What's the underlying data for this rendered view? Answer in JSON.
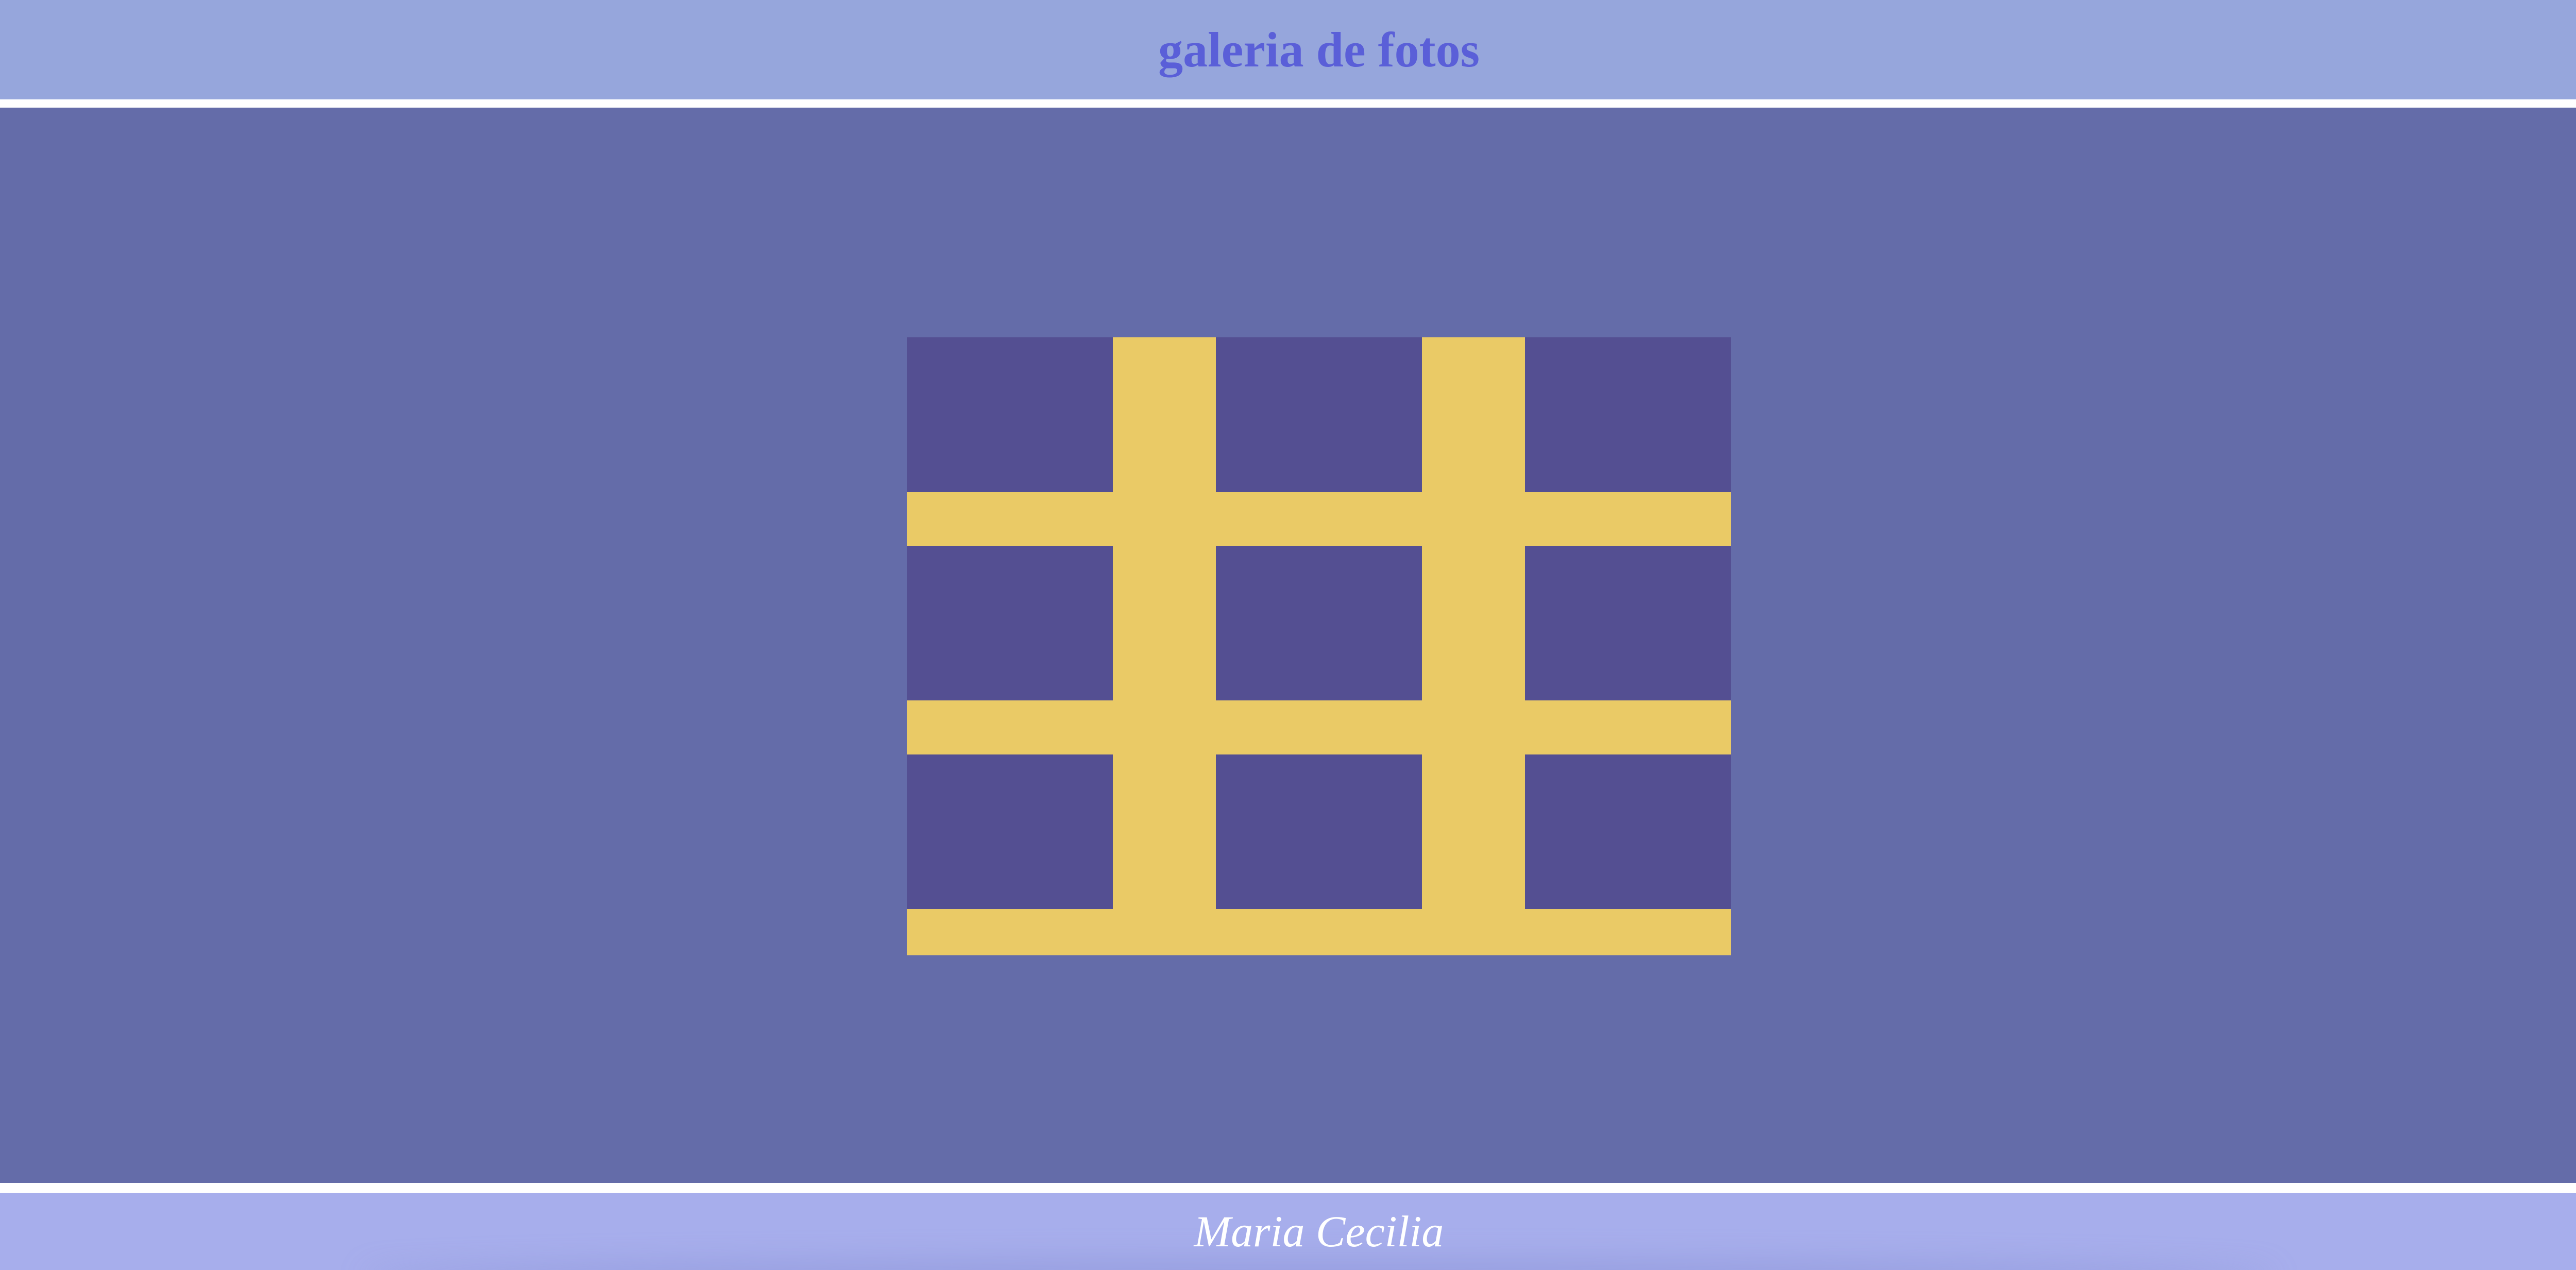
{
  "header": {
    "title": "galeria de fotos",
    "background": "#96a6dc",
    "title_color": "#5a5fd8"
  },
  "main": {
    "background": "#646ca9",
    "gallery": {
      "rows": 3,
      "columns": 3,
      "thumbnail_color": "#544f92",
      "gap_color": "#eaca66"
    }
  },
  "footer": {
    "author": "Maria Cecilia",
    "background": "#a7aeec",
    "text_color": "#ffffff"
  }
}
